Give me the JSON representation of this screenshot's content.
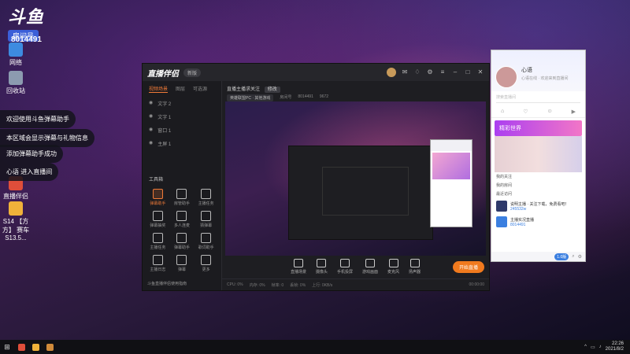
{
  "desktop": {
    "brand_logo": "斗鱼",
    "brand_tag": "房间号",
    "room_id": "8014491",
    "icons": [
      {
        "label": "网络",
        "icon": "network-icon"
      },
      {
        "label": "回收站",
        "icon": "recycle-bin-icon"
      },
      {
        "label": "直播伴侣",
        "icon": "live-companion-icon"
      },
      {
        "label": "S14 【方方】\n赛车S13.5...",
        "icon": "folder-icon"
      }
    ],
    "notices": [
      "欢迎使用斗鱼弹幕助手",
      "本区域会显示弹幕与礼物信息",
      "添加弹幕助手成功",
      "心语 进入直播间"
    ]
  },
  "app": {
    "logo": "直播伴侣",
    "version": "新版",
    "left_tabs": [
      "视频场景",
      "图层",
      "可选源"
    ],
    "scenes": [
      "文字 2",
      "文字 1",
      "窗口 1",
      "主屏 1"
    ],
    "tools_title": "工具箱",
    "tools": [
      "弹幕助手",
      "房管助手",
      "主播任务",
      "弹幕抽奖",
      "多人连麦",
      "猜弹幕",
      "主播任务",
      "弹幕助手",
      "歌词助手",
      "主播日志",
      "弹幕",
      "更多"
    ],
    "left_bottom": "斗鱼直播伴侣使用指南",
    "stream_title": "直播主播求关注",
    "edit_label": "修改",
    "category": "英雄联盟PC · 其他游戏",
    "room_label": "房间号",
    "room_num": "8014491",
    "fans_num": "9672",
    "bottom_tools": [
      "直播场景",
      "摄像头",
      "手机投屏",
      "游戏画面",
      "麦克风",
      "扬声器"
    ],
    "live_button": "开始直播",
    "status": [
      "CPU: 0%",
      "内存: 0%",
      "帧率: 0",
      "丢帧: 0%",
      "上行: 0KB/s",
      "00:00:00"
    ]
  },
  "panel": {
    "name": "心语",
    "sub": "心语在线 · 欢迎来到直播间",
    "search_placeholder": "搜索直播间",
    "banner": "精彩世界",
    "sections": [
      "我的关注",
      "我的房间",
      "最近访问"
    ],
    "item1_title": "说明主播 · 关注下载，免费看吧！",
    "item1_num": "245532w",
    "item2_title": "主播实况直播",
    "item2_num": "8014491",
    "foot_tag": "1.0版"
  },
  "taskbar": {
    "time": "22:26",
    "date": "2021/8/2"
  },
  "colors": {
    "accent": "#f07a1e",
    "panel_blue": "#3b7fe0"
  }
}
